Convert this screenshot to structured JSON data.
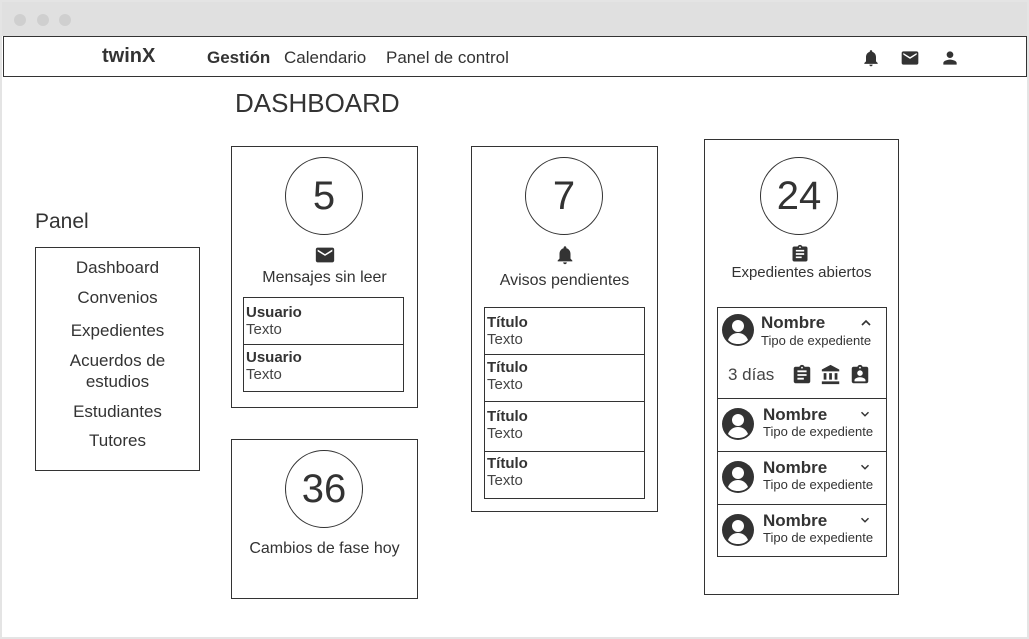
{
  "app": {
    "brand": "twinX"
  },
  "nav": {
    "items": [
      {
        "label": "Gestión",
        "active": true
      },
      {
        "label": "Calendario",
        "active": false
      },
      {
        "label": "Panel de control",
        "active": false
      }
    ],
    "icons": [
      "bell-icon",
      "mail-icon",
      "user-icon"
    ]
  },
  "page": {
    "title": "DASHBOARD"
  },
  "sidebar": {
    "title": "Panel",
    "items": [
      {
        "label": "Dashboard"
      },
      {
        "label": "Convenios"
      },
      {
        "label": "Expedientes"
      },
      {
        "label": "Acuerdos de estudios"
      },
      {
        "label": "Estudiantes"
      },
      {
        "label": "Tutores"
      }
    ]
  },
  "messages": {
    "count": "5",
    "label": "Mensajes sin leer",
    "rows": [
      {
        "user": "Usuario",
        "text": "Texto"
      },
      {
        "user": "Usuario",
        "text": "Texto"
      }
    ]
  },
  "phase_changes": {
    "count": "36",
    "label": "Cambios de fase hoy"
  },
  "notices": {
    "count": "7",
    "label": "Avisos pendientes",
    "rows": [
      {
        "title": "Título",
        "text": "Texto"
      },
      {
        "title": "Título",
        "text": "Texto"
      },
      {
        "title": "Título",
        "text": "Texto"
      },
      {
        "title": "Título",
        "text": "Texto"
      }
    ]
  },
  "files": {
    "count": "24",
    "label": "Expedientes abiertos",
    "expanded": {
      "name": "Nombre",
      "type": "Tipo de expediente",
      "days": "3 días"
    },
    "rows": [
      {
        "name": "Nombre",
        "type": "Tipo de expediente"
      },
      {
        "name": "Nombre",
        "type": "Tipo de expediente"
      },
      {
        "name": "Nombre",
        "type": "Tipo de expediente"
      }
    ]
  }
}
